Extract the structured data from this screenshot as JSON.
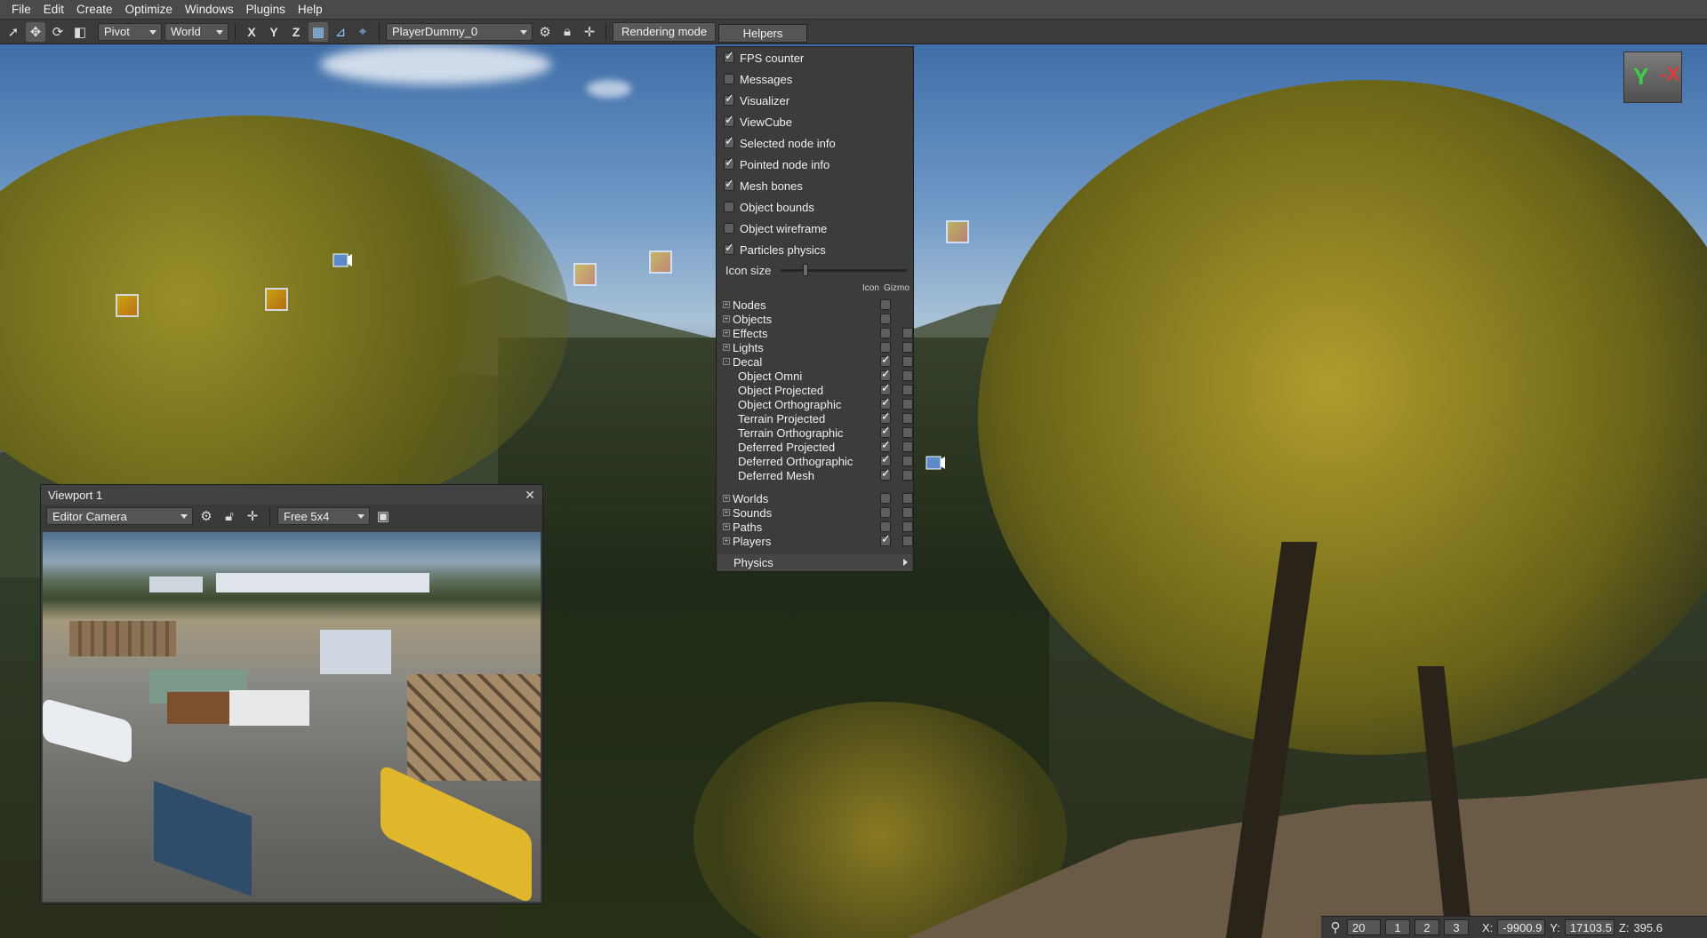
{
  "menubar": {
    "items": [
      "File",
      "Edit",
      "Create",
      "Optimize",
      "Windows",
      "Plugins",
      "Help"
    ]
  },
  "toolbar": {
    "pivot": "Pivot",
    "space": "World",
    "axes": [
      "X",
      "Y",
      "Z"
    ],
    "node": "PlayerDummy_0",
    "rendering_mode": "Rendering mode",
    "helpers": "Helpers"
  },
  "helpers": {
    "toggles": [
      {
        "label": "FPS counter",
        "checked": true
      },
      {
        "label": "Messages",
        "checked": false
      },
      {
        "label": "Visualizer",
        "checked": true
      },
      {
        "label": "ViewCube",
        "checked": true
      },
      {
        "label": "Selected node info",
        "checked": true
      },
      {
        "label": "Pointed node info",
        "checked": true
      },
      {
        "label": "Mesh bones",
        "checked": true
      },
      {
        "label": "Object bounds",
        "checked": false
      },
      {
        "label": "Object wireframe",
        "checked": false
      },
      {
        "label": "Particles physics",
        "checked": true
      }
    ],
    "icon_size_label": "Icon size",
    "icon_size_value": 0.2,
    "col_icon": "Icon",
    "col_gizmo": "Gizmo",
    "tree": [
      {
        "label": "Nodes",
        "expander": "+",
        "icon": false,
        "gizmo": null
      },
      {
        "label": "Objects",
        "expander": "+",
        "icon": false,
        "gizmo": null
      },
      {
        "label": "Effects",
        "expander": "+",
        "icon": false,
        "gizmo": false
      },
      {
        "label": "Lights",
        "expander": "+",
        "icon": false,
        "gizmo": false
      },
      {
        "label": "Decal",
        "expander": "-",
        "icon": true,
        "gizmo": false
      },
      {
        "label": "Object Omni",
        "child": true,
        "icon": true,
        "gizmo": false
      },
      {
        "label": "Object Projected",
        "child": true,
        "icon": true,
        "gizmo": false
      },
      {
        "label": "Object Orthographic",
        "child": true,
        "icon": true,
        "gizmo": false
      },
      {
        "label": "Terrain Projected",
        "child": true,
        "icon": true,
        "gizmo": false
      },
      {
        "label": "Terrain Orthographic",
        "child": true,
        "icon": true,
        "gizmo": false
      },
      {
        "label": "Deferred Projected",
        "child": true,
        "icon": true,
        "gizmo": false
      },
      {
        "label": "Deferred Orthographic",
        "child": true,
        "icon": true,
        "gizmo": false
      },
      {
        "label": "Deferred Mesh",
        "child": true,
        "icon": true,
        "gizmo": false
      },
      {
        "label": "Worlds",
        "expander": "+",
        "icon": false,
        "gizmo": false
      },
      {
        "label": "Sounds",
        "expander": "+",
        "icon": false,
        "gizmo": false
      },
      {
        "label": "Paths",
        "expander": "+",
        "icon": false,
        "gizmo": false
      },
      {
        "label": "Players",
        "expander": "+",
        "icon": true,
        "gizmo": false
      }
    ],
    "physics": "Physics"
  },
  "viewport": {
    "title": "Viewport 1",
    "camera": "Editor Camera",
    "aspect": "Free 5x4"
  },
  "viewcube": {
    "up": "Y",
    "side": "-X"
  },
  "status": {
    "speed": "20",
    "presets": [
      "1",
      "2",
      "3"
    ],
    "x_label": "X:",
    "x": "-9900.9",
    "y_label": "Y:",
    "y": "17103.5",
    "z_label": "Z:",
    "z": "395.6"
  }
}
